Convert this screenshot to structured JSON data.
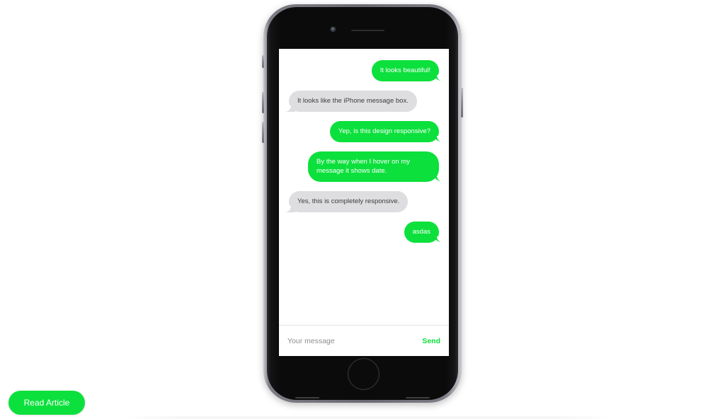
{
  "page": {
    "background_color": "#ffffff",
    "accent_color": "#0ce03c",
    "bubble_sent_color": "#0ce03c",
    "bubble_received_color": "#dedee1"
  },
  "phone": {
    "camera_icon": "camera-icon",
    "speaker_icon": "speaker-grille-icon",
    "home_button_label": "",
    "side_buttons": [
      {
        "name": "silent-switch"
      },
      {
        "name": "volume-up-button"
      },
      {
        "name": "volume-down-button"
      },
      {
        "name": "power-button"
      }
    ]
  },
  "conversation": {
    "messages": [
      {
        "id": 1,
        "direction": "sent",
        "text": "It looks beautiful!"
      },
      {
        "id": 2,
        "direction": "received",
        "text": "It looks like the iPhone message box."
      },
      {
        "id": 3,
        "direction": "sent",
        "text": "Yep, is this design responsive?"
      },
      {
        "id": 4,
        "direction": "sent",
        "text": "By the way when I hover on my message it shows date."
      },
      {
        "id": 5,
        "direction": "received",
        "text": "Yes, this is completely responsive."
      },
      {
        "id": 6,
        "direction": "sent",
        "text": "asdas"
      }
    ]
  },
  "composer": {
    "input_placeholder": "Your message",
    "input_value": "",
    "send_label": "Send"
  },
  "footer": {
    "read_article_label": "Read Article"
  }
}
